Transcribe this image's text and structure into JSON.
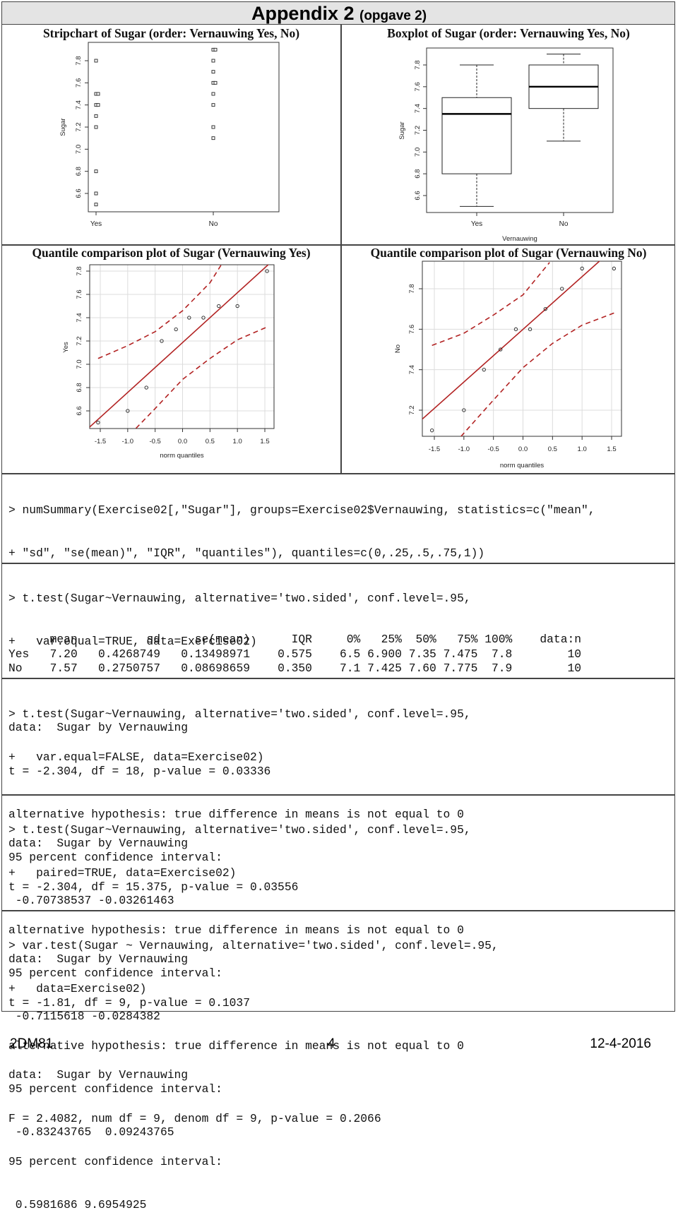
{
  "header": {
    "title": "Appendix 2",
    "subtitle": "(opgave 2)"
  },
  "chart_data": [
    {
      "id": "stripchart",
      "type": "scatter",
      "title": "Stripchart of Sugar (order: Vernauwing Yes, No)",
      "xlabel": "",
      "ylabel": "Sugar",
      "categories": [
        "Yes",
        "No"
      ],
      "series": [
        {
          "name": "Yes",
          "values": [
            6.5,
            6.6,
            6.8,
            7.2,
            7.3,
            7.4,
            7.4,
            7.5,
            7.5,
            7.8
          ]
        },
        {
          "name": "No",
          "values": [
            7.1,
            7.2,
            7.4,
            7.5,
            7.6,
            7.6,
            7.7,
            7.8,
            7.9,
            7.9
          ]
        }
      ],
      "yticks": [
        "6.6",
        "6.8",
        "7.0",
        "7.2",
        "7.4",
        "7.6",
        "7.8"
      ],
      "ylim": [
        6.45,
        7.95
      ],
      "grid": false
    },
    {
      "id": "boxplot",
      "type": "box",
      "title": "Boxplot of Sugar (order: Vernauwing Yes, No)",
      "xlabel": "Vernauwing",
      "ylabel": "Sugar",
      "categories": [
        "Yes",
        "No"
      ],
      "boxes": [
        {
          "name": "Yes",
          "min": 6.5,
          "q1": 6.8,
          "median": 7.35,
          "q3": 7.5,
          "max": 7.8
        },
        {
          "name": "No",
          "min": 7.1,
          "q1": 7.4,
          "median": 7.6,
          "q3": 7.8,
          "max": 7.9
        }
      ],
      "yticks": [
        "6.6",
        "6.8",
        "7.0",
        "7.2",
        "7.4",
        "7.6",
        "7.8"
      ],
      "ylim": [
        6.45,
        7.95
      ],
      "grid": false
    },
    {
      "id": "qq-yes",
      "type": "scatter",
      "title": "Quantile comparison plot of Sugar (Vernauwing Yes)",
      "xlabel": "norm quantiles",
      "ylabel": "Yes",
      "points": [
        [
          -1.54,
          6.5
        ],
        [
          -1.0,
          6.6
        ],
        [
          -0.66,
          6.8
        ],
        [
          -0.38,
          7.2
        ],
        [
          -0.12,
          7.3
        ],
        [
          0.12,
          7.4
        ],
        [
          0.38,
          7.4
        ],
        [
          0.66,
          7.5
        ],
        [
          1.0,
          7.5
        ],
        [
          1.54,
          7.8
        ]
      ],
      "reference_line": [
        [
          -1.65,
          6.48
        ],
        [
          1.55,
          7.85
        ]
      ],
      "upper_band": [
        [
          -1.54,
          7.05
        ],
        [
          -1.0,
          7.16
        ],
        [
          -0.5,
          7.28
        ],
        [
          0.0,
          7.46
        ],
        [
          0.5,
          7.7
        ],
        [
          0.7,
          7.85
        ]
      ],
      "lower_band": [
        [
          -0.85,
          6.45
        ],
        [
          -0.5,
          6.62
        ],
        [
          0.0,
          6.87
        ],
        [
          0.5,
          7.05
        ],
        [
          1.0,
          7.21
        ],
        [
          1.54,
          7.32
        ]
      ],
      "xticks": [
        "-1.5",
        "-1.0",
        "-0.5",
        "0.0",
        "0.5",
        "1.0",
        "1.5"
      ],
      "yticks": [
        "6.6",
        "6.8",
        "7.0",
        "7.2",
        "7.4",
        "7.6",
        "7.8"
      ],
      "xlim": [
        -1.66,
        1.66
      ],
      "ylim": [
        6.45,
        7.85
      ],
      "grid": true,
      "line_color": "#b22222"
    },
    {
      "id": "qq-no",
      "type": "scatter",
      "title": "Quantile comparison plot of Sugar (Vernauwing No)",
      "xlabel": "norm quantiles",
      "ylabel": "No",
      "points": [
        [
          -1.54,
          7.1
        ],
        [
          -1.0,
          7.2
        ],
        [
          -0.66,
          7.4
        ],
        [
          -0.38,
          7.5
        ],
        [
          -0.12,
          7.6
        ],
        [
          0.12,
          7.6
        ],
        [
          0.38,
          7.7
        ],
        [
          0.66,
          7.8
        ],
        [
          1.0,
          7.9
        ],
        [
          1.54,
          7.9
        ]
      ],
      "reference_line": [
        [
          -1.65,
          7.17
        ],
        [
          1.27,
          7.93
        ]
      ],
      "upper_band": [
        [
          -1.54,
          7.52
        ],
        [
          -1.0,
          7.58
        ],
        [
          -0.5,
          7.67
        ],
        [
          0.0,
          7.77
        ],
        [
          0.45,
          7.93
        ]
      ],
      "lower_band": [
        [
          -1.05,
          7.07
        ],
        [
          -0.5,
          7.25
        ],
        [
          0.0,
          7.41
        ],
        [
          0.5,
          7.53
        ],
        [
          1.0,
          7.62
        ],
        [
          1.54,
          7.68
        ]
      ],
      "xticks": [
        "-1.5",
        "-1.0",
        "-0.5",
        "0.0",
        "0.5",
        "1.0",
        "1.5"
      ],
      "yticks": [
        "7.2",
        "7.4",
        "7.6",
        "7.8"
      ],
      "xlim": [
        -1.66,
        1.66
      ],
      "ylim": [
        7.07,
        7.93
      ],
      "grid": true,
      "line_color": "#b22222"
    }
  ],
  "console": {
    "numsummary": {
      "command": [
        "> numSummary(Exercise02[,\"Sugar\"], groups=Exercise02$Vernauwing, statistics=c(\"mean\",",
        "+ \"sd\", \"se(mean)\", \"IQR\", \"quantiles\"), quantiles=c(0,.25,.5,.75,1))"
      ],
      "table": {
        "columns": [
          "",
          "mean",
          "sd",
          "se(mean)",
          "IQR",
          "0%",
          "25%",
          "50%",
          "75%",
          "100%",
          "data:n"
        ],
        "rows": [
          [
            "Yes",
            "7.20",
            "0.4268749",
            "0.13498971",
            "0.575",
            "6.5",
            "6.900",
            "7.35",
            "7.475",
            "7.8",
            "10"
          ],
          [
            "No",
            "7.57",
            "0.2750757",
            "0.08698659",
            "0.350",
            "7.1",
            "7.425",
            "7.60",
            "7.775",
            "7.9",
            "10"
          ]
        ]
      }
    },
    "tests": [
      {
        "command": [
          "> t.test(Sugar~Vernauwing, alternative='two.sided', conf.level=.95,",
          "+   var.equal=TRUE, data=Exercise02)"
        ],
        "output": [
          "data:  Sugar by Vernauwing",
          "t = -2.304, df = 18, p-value = 0.03336",
          "alternative hypothesis: true difference in means is not equal to 0",
          "95 percent confidence interval:",
          " -0.70738537 -0.03261463"
        ]
      },
      {
        "command": [
          "> t.test(Sugar~Vernauwing, alternative='two.sided', conf.level=.95,",
          "+   var.equal=FALSE, data=Exercise02)"
        ],
        "output": [
          "data:  Sugar by Vernauwing",
          "t = -2.304, df = 15.375, p-value = 0.03556",
          "alternative hypothesis: true difference in means is not equal to 0",
          "95 percent confidence interval:",
          " -0.7115618 -0.0284382"
        ]
      },
      {
        "command": [
          "> t.test(Sugar~Vernauwing, alternative='two.sided', conf.level=.95,",
          "+   paired=TRUE, data=Exercise02)"
        ],
        "output": [
          "data:  Sugar by Vernauwing",
          "t = -1.81, df = 9, p-value = 0.1037",
          "alternative hypothesis: true difference in means is not equal to 0",
          "95 percent confidence interval:",
          " -0.83243765  0.09243765"
        ]
      },
      {
        "command": [
          "> var.test(Sugar ~ Vernauwing, alternative='two.sided', conf.level=.95,",
          "+   data=Exercise02)"
        ],
        "output": [
          "data:  Sugar by Vernauwing",
          "F = 2.4082, num df = 9, denom df = 9, p-value = 0.2066",
          "95 percent confidence interval:",
          " 0.5981686 9.6954925"
        ]
      }
    ]
  },
  "footer": {
    "course": "2DM81",
    "page": "4",
    "date": "12-4-2016"
  }
}
